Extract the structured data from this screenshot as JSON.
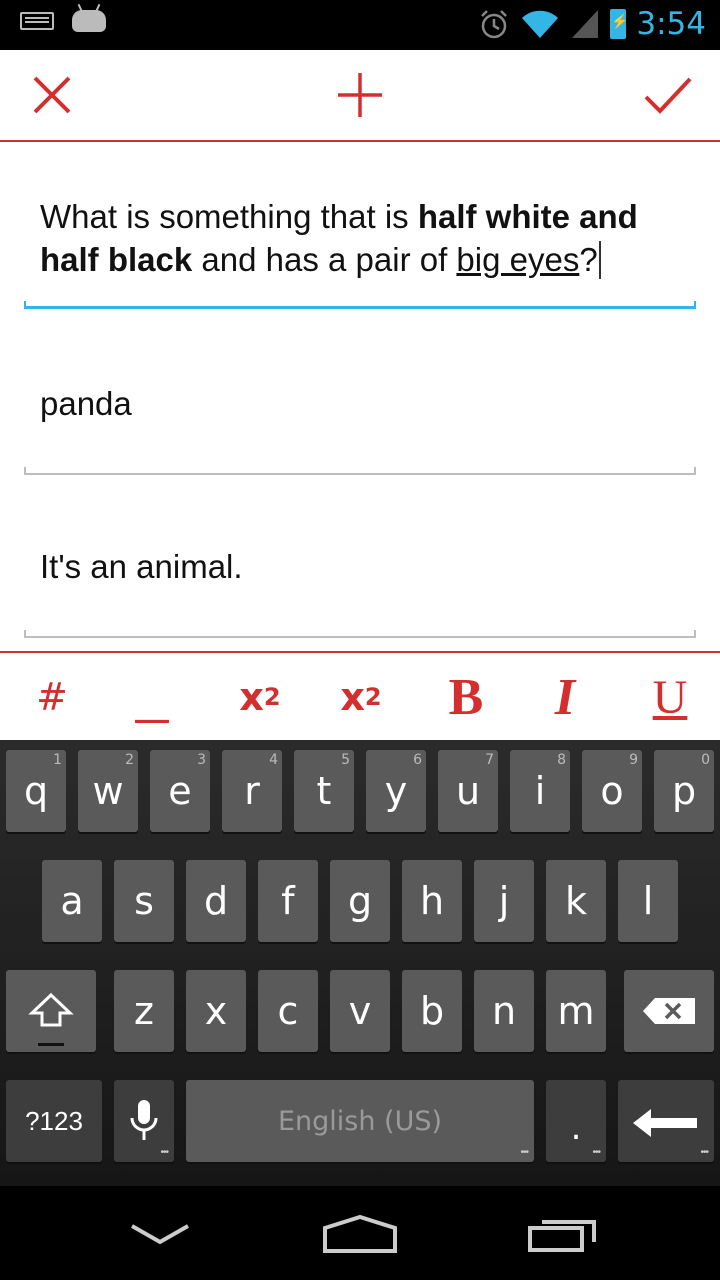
{
  "status_bar": {
    "time": "3:54",
    "icons": [
      "keyboard-icon",
      "android-icon",
      "alarm-icon",
      "wifi-icon",
      "signal-icon",
      "battery-charging-icon"
    ]
  },
  "toolbar": {
    "close_icon": "close-icon",
    "add_icon": "plus-icon",
    "confirm_icon": "check-icon",
    "accent_color": "#d32f2f"
  },
  "question": {
    "parts": [
      "What is something that is ",
      "half white and half black",
      " and has a pair of ",
      "big eyes",
      "?"
    ]
  },
  "answer": {
    "value": "panda"
  },
  "hint": {
    "value": "It's an animal."
  },
  "format_bar": {
    "hash": "#",
    "underscore": "__",
    "superscript_base": "x",
    "superscript_exp": "2",
    "subscript_base": "x",
    "subscript_idx": "2",
    "bold": "B",
    "italic": "I",
    "underline": "U"
  },
  "keyboard": {
    "row1": [
      {
        "key": "q",
        "hint": "1"
      },
      {
        "key": "w",
        "hint": "2"
      },
      {
        "key": "e",
        "hint": "3"
      },
      {
        "key": "r",
        "hint": "4"
      },
      {
        "key": "t",
        "hint": "5"
      },
      {
        "key": "y",
        "hint": "6"
      },
      {
        "key": "u",
        "hint": "7"
      },
      {
        "key": "i",
        "hint": "8"
      },
      {
        "key": "o",
        "hint": "9"
      },
      {
        "key": "p",
        "hint": "0"
      }
    ],
    "row2": [
      "a",
      "s",
      "d",
      "f",
      "g",
      "h",
      "j",
      "k",
      "l"
    ],
    "row3": [
      "z",
      "x",
      "c",
      "v",
      "b",
      "n",
      "m"
    ],
    "symbols_label": "?123",
    "space_label": "English (US)",
    "period_label": "."
  },
  "nav_bar": {
    "icons": [
      "back-icon",
      "home-icon",
      "recents-icon"
    ]
  }
}
